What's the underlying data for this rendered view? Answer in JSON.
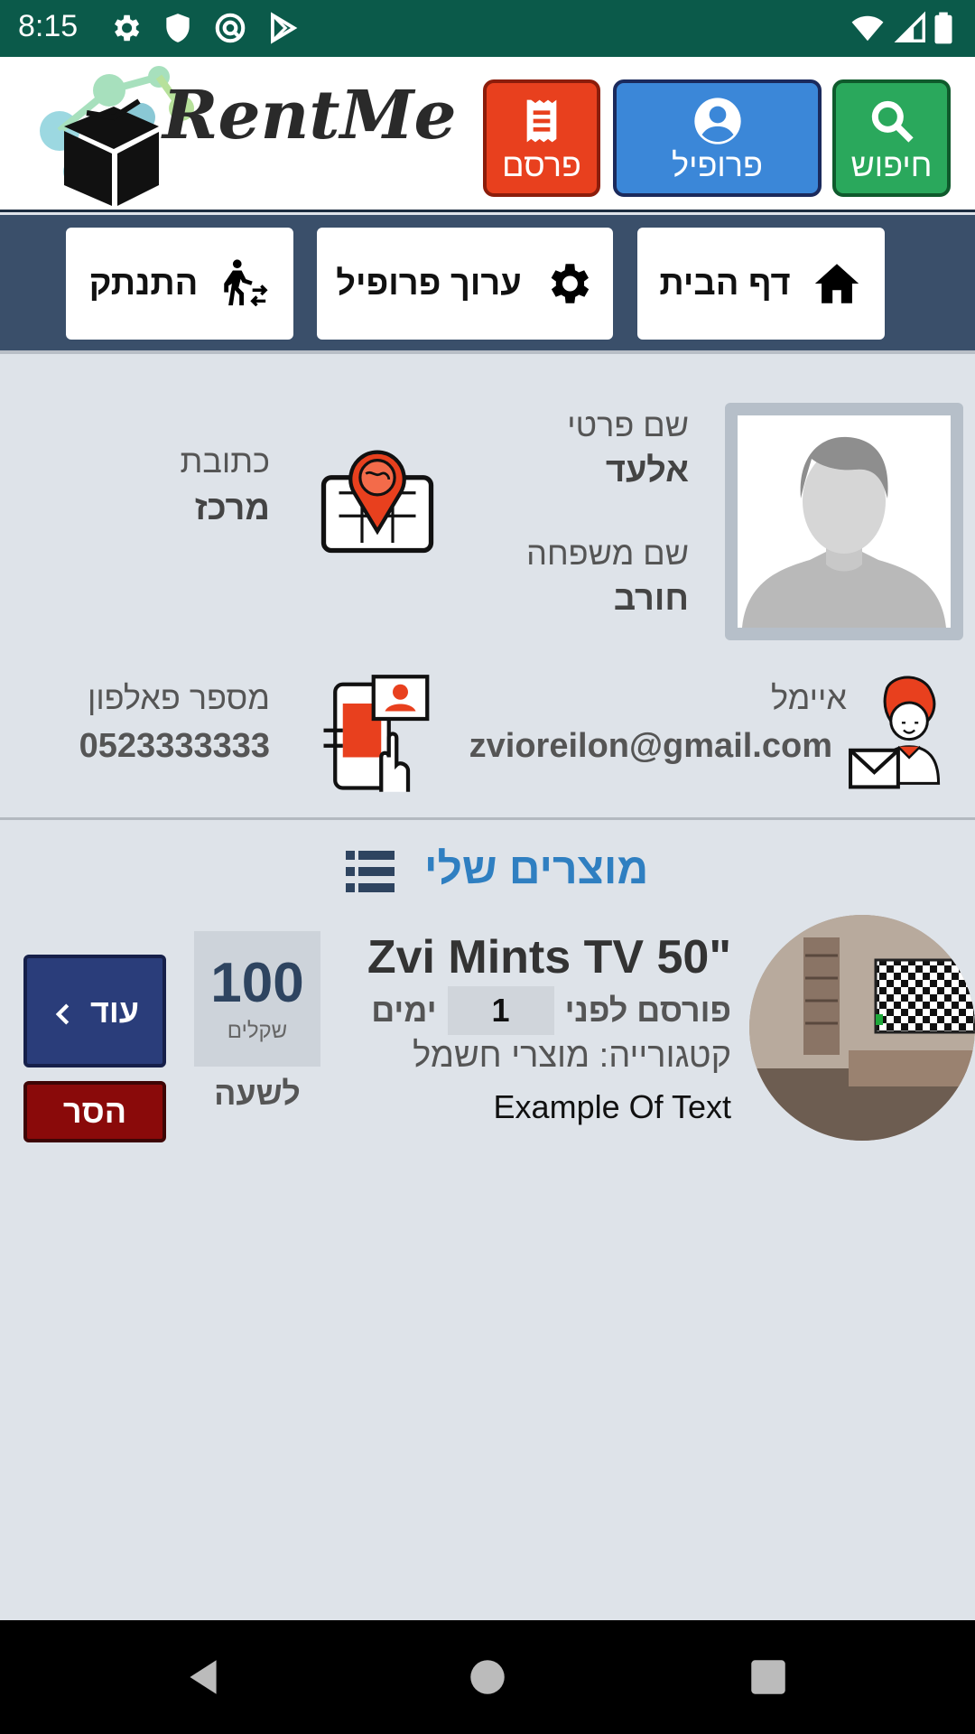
{
  "status_bar": {
    "time": "8:15"
  },
  "header": {
    "brand": "RentMe",
    "buttons": {
      "publish": "פרסם",
      "profile": "פרופיל",
      "search": "חיפוש"
    }
  },
  "nav": {
    "home": "דף הבית",
    "edit_profile": "ערוך פרופיל",
    "logout": "התנתק"
  },
  "profile": {
    "first_name_label": "שם פרטי",
    "first_name": "אלעד",
    "last_name_label": "שם משפחה",
    "last_name": "חורב",
    "address_label": "כתובת",
    "address": "מרכז",
    "email_label": "איימל",
    "email": "zvioreilon@gmail.com",
    "phone_label": "מספר פאלפון",
    "phone": "0523333333"
  },
  "products": {
    "section_title": "מוצרים שלי",
    "items": [
      {
        "title": "Zvi Mints TV 50\"",
        "posted_prefix": "פורסם לפני",
        "days": "1",
        "days_suffix": "ימים",
        "category": "קטגורייה: מוצרי חשמל",
        "description": "Example Of Text",
        "price": "100",
        "currency": "שקלים",
        "per": "לשעה",
        "more_label": "עוד",
        "remove_label": "הסר"
      }
    ]
  },
  "colors": {
    "status_bar": "#0b5a4a",
    "publish": "#e8401e",
    "profile": "#3b87d8",
    "search": "#2aa85c",
    "nav_bar": "#3a4f6a",
    "section_title": "#2f7fc1",
    "more": "#2a3d7a",
    "remove": "#8a0a0a"
  }
}
